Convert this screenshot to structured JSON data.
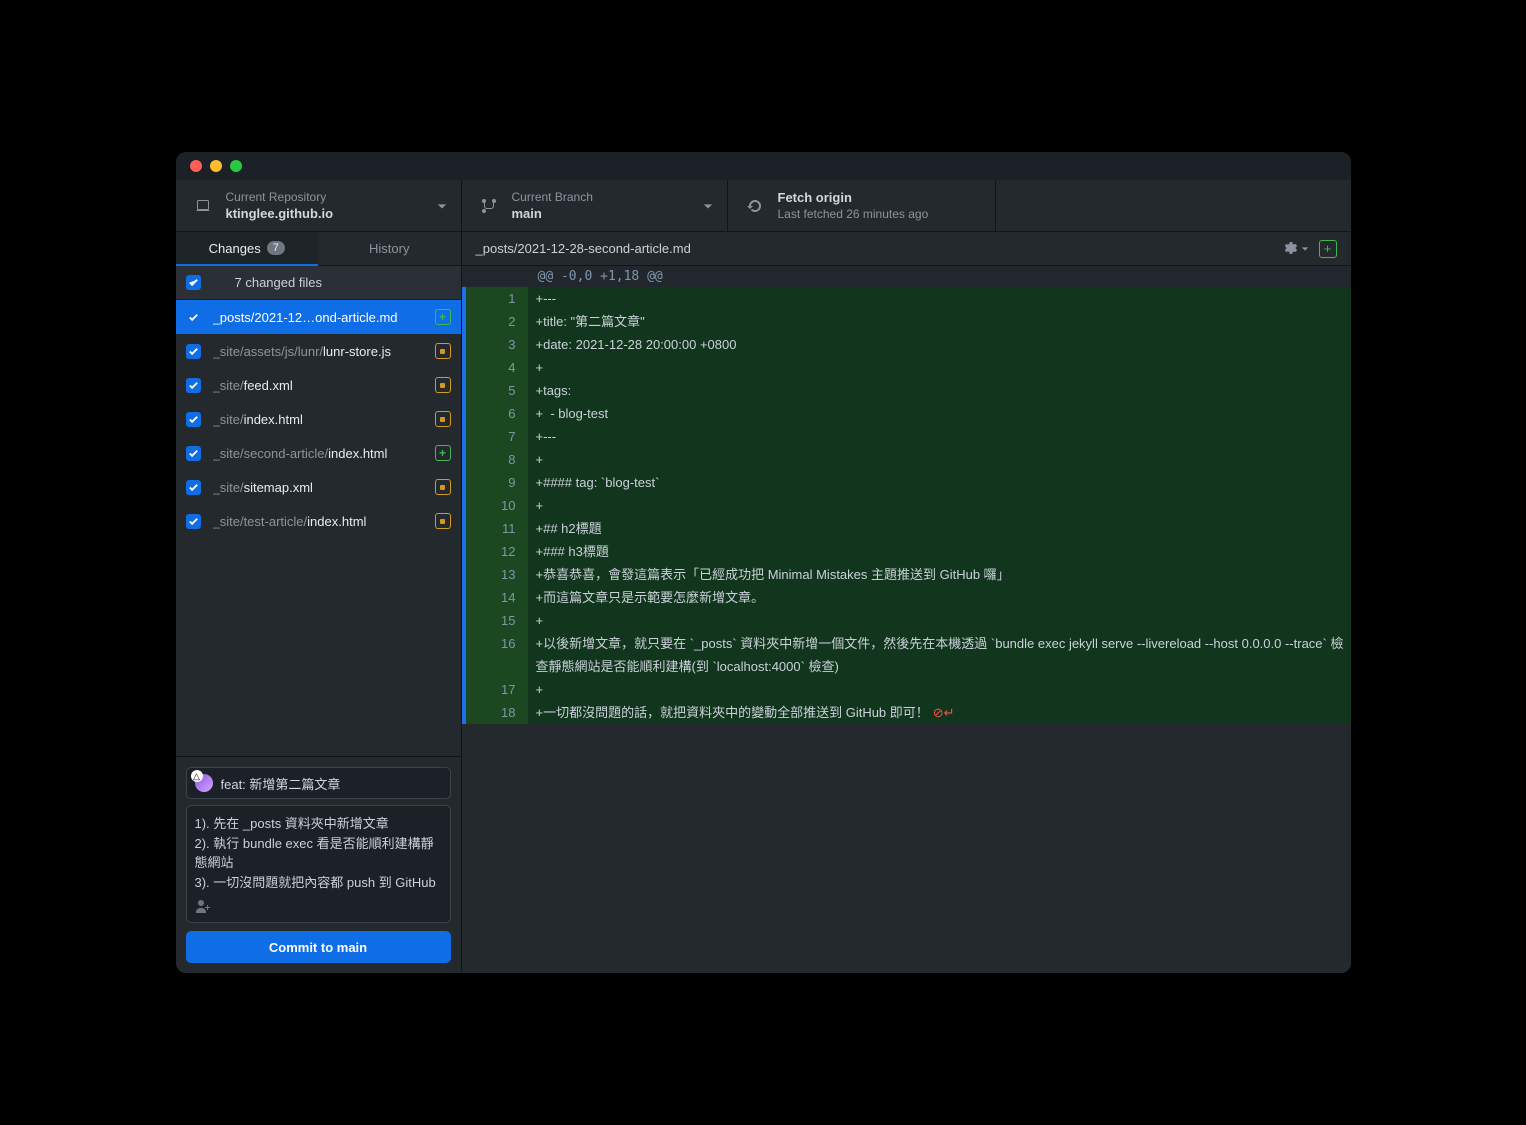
{
  "toolbar": {
    "repo": {
      "label": "Current Repository",
      "value": "ktinglee.github.io"
    },
    "branch": {
      "label": "Current Branch",
      "value": "main"
    },
    "fetch": {
      "label": "Fetch origin",
      "sub": "Last fetched 26 minutes ago"
    }
  },
  "tabs": {
    "changes": "Changes",
    "changes_count": "7",
    "history": "History"
  },
  "changed_header": "7 changed files",
  "files": [
    {
      "dir": "_posts/",
      "name": "2021-12…ond-article.md",
      "status": "added",
      "selected": true
    },
    {
      "dir": "_site/assets/js/lunr/",
      "name": "lunr-store.js",
      "status": "modified"
    },
    {
      "dir": "_site/",
      "name": "feed.xml",
      "status": "modified"
    },
    {
      "dir": "_site/",
      "name": "index.html",
      "status": "modified"
    },
    {
      "dir": "_site/second-article/",
      "name": "index.html",
      "status": "added"
    },
    {
      "dir": "_site/",
      "name": "sitemap.xml",
      "status": "modified"
    },
    {
      "dir": "_site/test-article/",
      "name": "index.html",
      "status": "modified"
    }
  ],
  "commit": {
    "summary": "feat: 新增第二篇文章",
    "description": "1). 先在 _posts 資料夾中新增文章\n2). 執行 bundle exec 看是否能順利建構靜態網站\n3). 一切沒問題就把內容都 push 到 GitHub",
    "button_prefix": "Commit to ",
    "button_branch": "main"
  },
  "diff": {
    "filepath": "_posts/2021-12-28-second-article.md",
    "hunk": "@@ -0,0 +1,18 @@",
    "lines": [
      {
        "n": 1,
        "t": "+---"
      },
      {
        "n": 2,
        "t": "+title: \"第二篇文章\""
      },
      {
        "n": 3,
        "t": "+date: 2021-12-28 20:00:00 +0800"
      },
      {
        "n": 4,
        "t": "+"
      },
      {
        "n": 5,
        "t": "+tags:"
      },
      {
        "n": 6,
        "t": "+  - blog-test"
      },
      {
        "n": 7,
        "t": "+---"
      },
      {
        "n": 8,
        "t": "+"
      },
      {
        "n": 9,
        "t": "+#### tag: `blog-test`"
      },
      {
        "n": 10,
        "t": "+"
      },
      {
        "n": 11,
        "t": "+## h2標題"
      },
      {
        "n": 12,
        "t": "+### h3標題"
      },
      {
        "n": 13,
        "t": "+恭喜恭喜，會發這篇表示「已經成功把 Minimal Mistakes 主題推送到 GitHub 囉」"
      },
      {
        "n": 14,
        "t": "+而這篇文章只是示範要怎麼新增文章。"
      },
      {
        "n": 15,
        "t": "+"
      },
      {
        "n": 16,
        "t": "+以後新增文章，就只要在 `_posts` 資料夾中新增一個文件，然後先在本機透過 `bundle exec jekyll serve --livereload --host 0.0.0.0 --trace` 檢查靜態網站是否能順利建構(到 `localhost:4000` 檢查)"
      },
      {
        "n": 17,
        "t": "+"
      },
      {
        "n": 18,
        "t": "+一切都沒問題的話，就把資料夾中的變動全部推送到 GitHub 即可！",
        "noNewline": true
      }
    ]
  }
}
